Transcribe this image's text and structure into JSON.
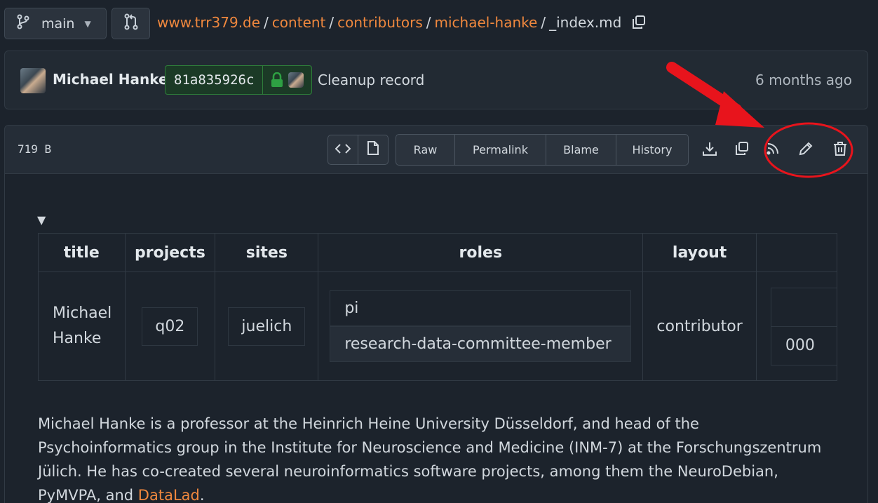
{
  "branch": {
    "name": "main"
  },
  "breadcrumb": {
    "parts": [
      "www.trr379.de",
      "content",
      "contributors",
      "michael-hanke"
    ],
    "file": "_index.md"
  },
  "commit": {
    "author": "Michael Hanke",
    "sha": "81a835926c",
    "message": "Cleanup record",
    "time": "6 months ago"
  },
  "file": {
    "size": "719 B",
    "actions": [
      "Raw",
      "Permalink",
      "Blame",
      "History"
    ]
  },
  "table": {
    "headers": [
      "title",
      "projects",
      "sites",
      "roles",
      "layout"
    ],
    "row": {
      "title": "Michael Hanke",
      "projects": "q02",
      "sites": "juelich",
      "roles": [
        "pi",
        "research-data-committee-member"
      ],
      "layout": "contributor",
      "extra": "000"
    }
  },
  "bio": {
    "text": "Michael Hanke is a professor at the Heinrich Heine University Düsseldorf, and head of the Psychoinformatics group in the Institute for Neuroscience and Medicine (INM-7) at the Forschungszentrum Jülich. He has co-created several neuroinformatics software projects, among them the NeuroDebian, PyMVPA, and ",
    "link": "DataLad",
    "end": "."
  },
  "colors": {
    "accent": "#f0883e",
    "annotation": "#e8141c",
    "verified": "#2ea043"
  },
  "icons": [
    "branch-icon",
    "chevron-down-icon",
    "pull-request-icon",
    "copy-icon",
    "lock-icon",
    "code-icon",
    "file-icon",
    "download-icon",
    "rss-icon",
    "pencil-icon",
    "trash-icon"
  ]
}
